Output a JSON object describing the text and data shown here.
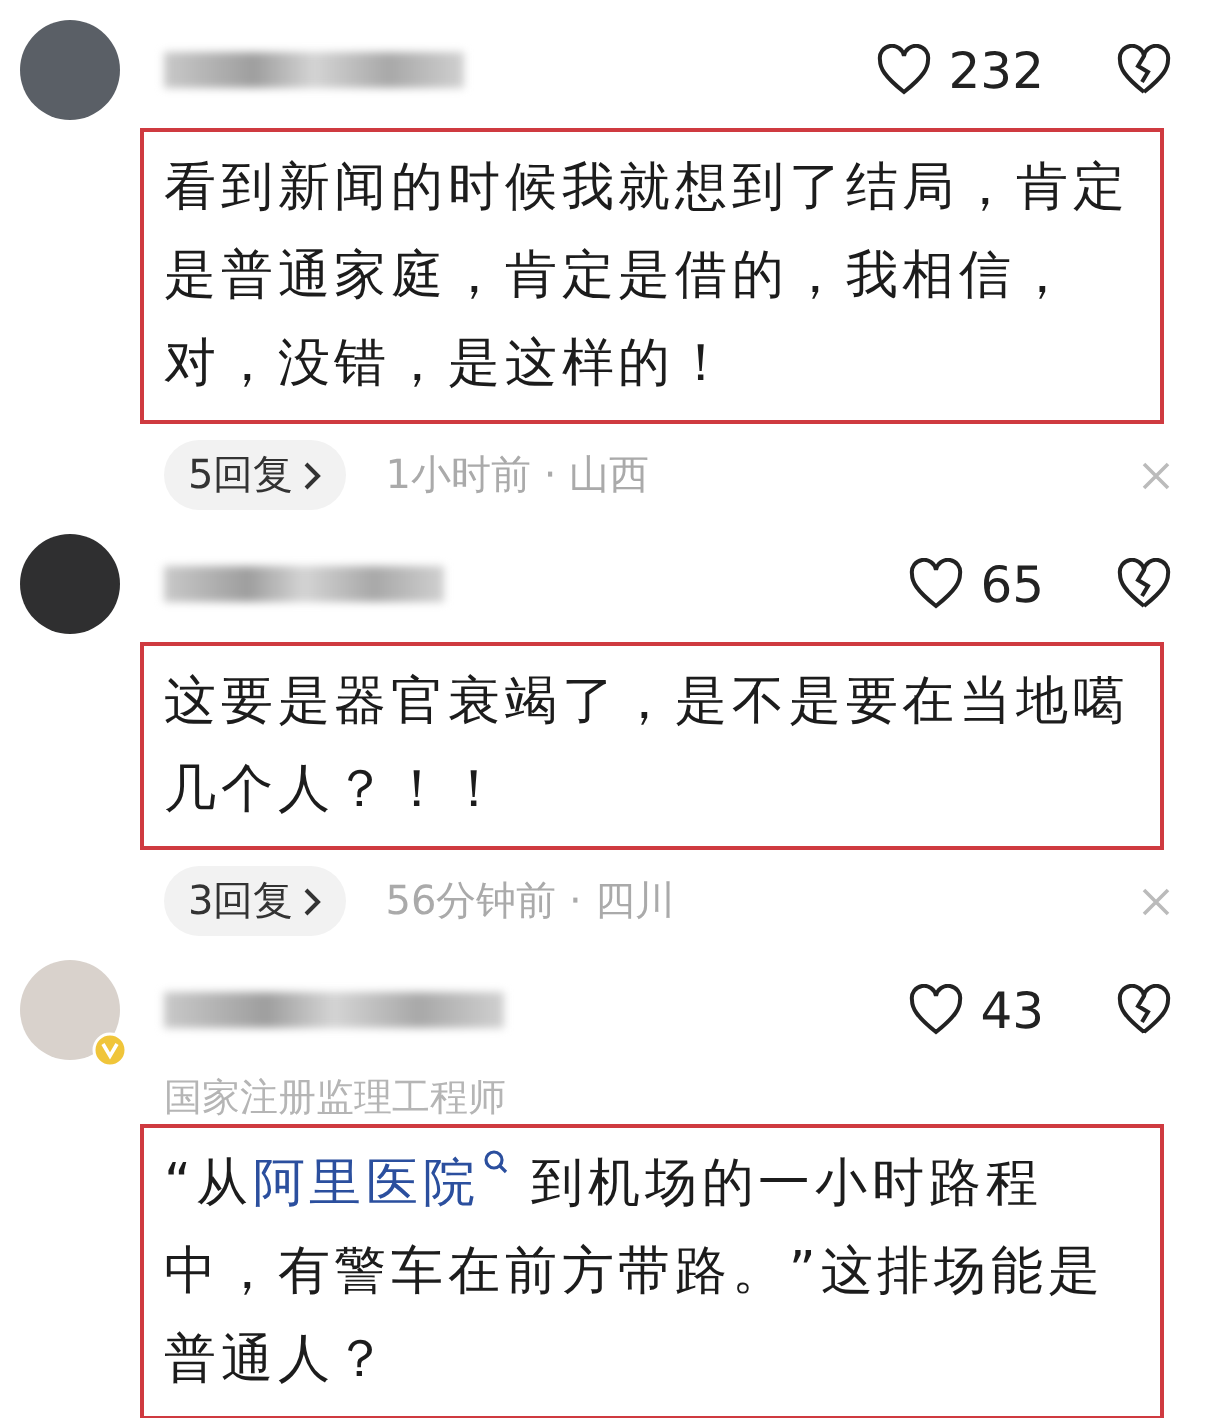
{
  "comments": [
    {
      "likes": "232",
      "content": [
        {
          "kind": "text",
          "text": "看到新闻的时候我就想到了结局，肯定是普通家庭，肯定是借的，我相信，对，没错，是这样的！"
        }
      ],
      "replies": "5回复",
      "meta": "1小时前 · 山西"
    },
    {
      "likes": "65",
      "content": [
        {
          "kind": "text",
          "text": "这要是器官衰竭了，是不是要在当地噶几个人？！！"
        }
      ],
      "replies": "3回复",
      "meta": "56分钟前 · 四川"
    },
    {
      "likes": "43",
      "verified": true,
      "title": "国家注册监理工程师",
      "content": [
        {
          "kind": "text",
          "text": "“从"
        },
        {
          "kind": "link",
          "text": "阿里医院"
        },
        {
          "kind": "text",
          "text": " 到机场的一小时路程中，有警车在前方带路。”这排场能是普通人？"
        }
      ]
    }
  ]
}
